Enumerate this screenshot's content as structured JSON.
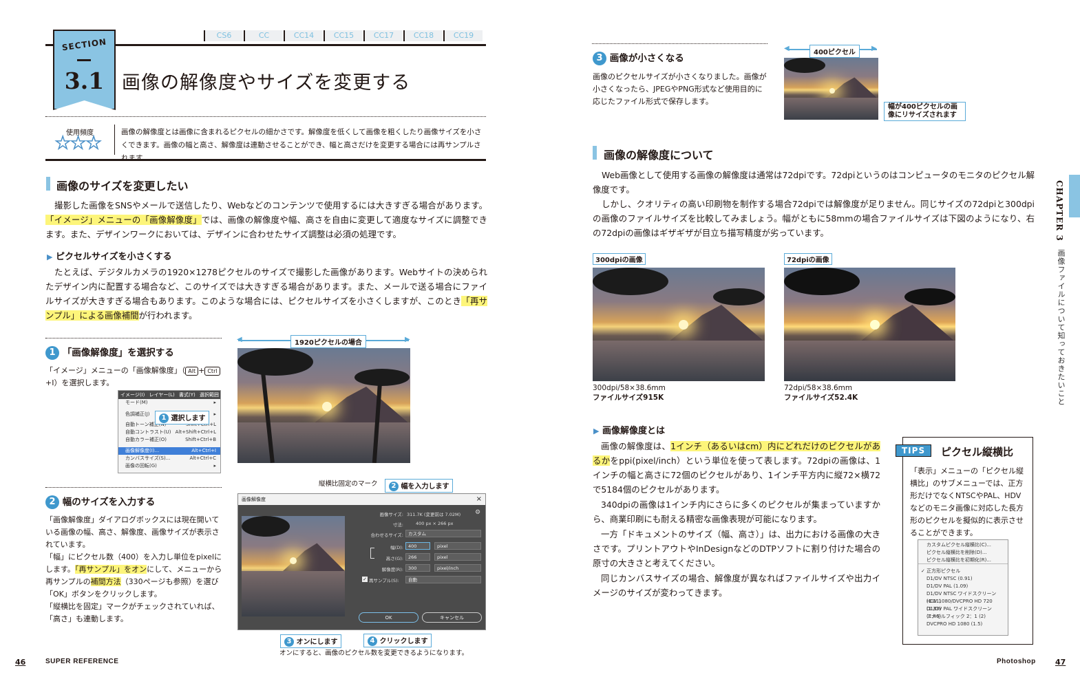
{
  "header": {
    "section_word": "SECTION",
    "section_num": "3.1",
    "title": "画像の解像度やサイズを変更する",
    "versions": [
      "CS6",
      "CC",
      "CC14",
      "CC15",
      "CC17",
      "CC18",
      "CC19"
    ]
  },
  "frequency": {
    "label": "使用頻度",
    "stars": "★★★",
    "rating": 3
  },
  "intro": "画像の解像度とは画像に含まれるピクセルの細かさです。解像度を低くして画像を粗くしたり画像サイズを小さくできます。画像の幅と高さ、解像度は連動させることができ、幅と高さだけを変更する場合には再サンプルされます。",
  "section_a": {
    "heading": "画像のサイズを変更したい",
    "p1_a": "撮影した画像をSNSやメールで送信したり、Webなどのコンテンツで使用するには大きすぎる場合があります。",
    "p1_hl": "「イメージ」メニューの「画像解像度」",
    "p1_b": "では、画像の解像度や幅、高さを自由に変更して適度なサイズに調整できます。また、デザインワークにおいては、デザインに合わせたサイズ調整は必須の処理です。",
    "sub": "ピクセルサイズを小さくする",
    "p2_a": "たとえば、デジタルカメラの1920×1278ピクセルのサイズで撮影した画像があります。Webサイトの決められたデザイン内に配置する場合など、このサイズでは大きすぎる場合があります。また、メールで送る場合にファイルサイズが大きすぎる場合もあります。このような場合には、ピクセルサイズを小さくしますが、このとき",
    "p2_hl": "「再サンプル」による画像補間",
    "p2_b": "が行われます。"
  },
  "step1": {
    "num": "1",
    "title": "「画像解像度」を選択する",
    "text_a": "「イメージ」メニューの「画像解像度」（",
    "key1": "Alt",
    "plus": "+",
    "key2": "Ctrl",
    "text_b": "+I）を選択します。",
    "callout_num": "1",
    "callout": "選択します",
    "menu_bar": "イメージ(I)  レイヤー(L)  書式(Y)  選択範囲",
    "menu_items": [
      {
        "label": "モード(M)",
        "shortcut": "▸"
      },
      {
        "label": "色調補正(J)",
        "shortcut": "▸"
      },
      {
        "label": "自動トーン補正(N)",
        "shortcut": "Shift+Ctrl+L"
      },
      {
        "label": "自動コントラスト(U)",
        "shortcut": "Alt+Shift+Ctrl+L"
      },
      {
        "label": "自動カラー補正(O)",
        "shortcut": "Shift+Ctrl+B"
      },
      {
        "label": "画像解像度(I)...",
        "shortcut": "Alt+Ctrl+I"
      },
      {
        "label": "カンバスサイズ(S)...",
        "shortcut": "Alt+Ctrl+C"
      },
      {
        "label": "画像の回転(G)",
        "shortcut": "▸"
      }
    ],
    "photo_label": "1920ピクセルの場合"
  },
  "step2": {
    "num": "2",
    "title": "幅のサイズを入力する",
    "t1": "「画像解像度」ダイアログボックスには現在開いている画像の幅、高さ、解像度、画像サイズが表示されています。",
    "t2": "「幅」にピクセル数（400）を入力し単位をpixelにします。",
    "t2_hl": "「再サンプル」をオン",
    "t3": "にして、メニューから再サンプルの",
    "t3_hl": "補間方法",
    "t4": "（330ページも参照）を選び「OK」ボタンをクリックします。",
    "t5": "「縦横比を固定」マークがチェックされていれば、「高さ」も連動します。",
    "mark_label": "縦横比固定のマーク",
    "c2_num": "2",
    "c2": "幅を入力します",
    "c3_num": "3",
    "c3": "オンにします",
    "c4_num": "4",
    "c4": "クリックします",
    "note": "オンにすると、画像のピクセル数を変更できるようになります。",
    "dialog": {
      "title": "画像解像度",
      "close": "×",
      "rows": [
        {
          "label": "画像サイズ:",
          "value": "311.7K (変更前は 7.02M)"
        },
        {
          "label": "寸法:",
          "value": "400 px × 266 px"
        },
        {
          "label": "合わせるサイズ:",
          "value": "カスタム"
        },
        {
          "label": "幅(D):",
          "value": "400",
          "unit": "pixel"
        },
        {
          "label": "高さ(G):",
          "value": "266",
          "unit": "pixel"
        },
        {
          "label": "解像度(R):",
          "value": "300",
          "unit": "pixel/inch"
        },
        {
          "label": "再サンプル(S):",
          "value": "自動"
        }
      ],
      "ok": "OK",
      "cancel": "キャンセル"
    }
  },
  "step3": {
    "num": "3",
    "title": "画像が小さくなる",
    "text": "画像のピクセルサイズが小さくなりました。画像が小さくなったら、JPEGやPNG形式など使用目的に応じたファイル形式で保存します。",
    "photo_label": "400ピクセル",
    "callout": "幅が400ピクセルの画像にリサイズされます"
  },
  "section_b": {
    "heading": "画像の解像度について",
    "p1": "Web画像として使用する画像の解像度は通常は72dpiです。72dpiというのはコンピュータのモニタのピクセル解像度です。",
    "p2": "しかし、クオリティの高い印刷物を制作する場合72dpiでは解像度が足りません。同じサイズの72dpiと300dpiの画像のファイルサイズを比較してみましょう。幅がともに58mmの場合ファイルサイズは下図のようになり、右の72dpiの画像はギザギザが目立ち描写精度が劣っています。",
    "img1_label": "300dpiの画像",
    "img1_cap1": "300dpi/58×38.6mm",
    "img1_cap2": "ファイルサイズ915K",
    "img2_label": "72dpiの画像",
    "img2_cap1": "72dpi/58×38.6mm",
    "img2_cap2": "ファイルサイズ52.4K",
    "sub": "画像解像度とは",
    "q1_a": "画像の解像度は、",
    "q1_hl": "1インチ（あるいはcm）内にどれだけのピクセルがあるか",
    "q1_b": "をppi(pixel/inch）という単位を使って表します。72dpiの画像は、1インチの幅と高さに72個のピクセルがあり、1インチ平方内に縦72×横72で5184個のピクセルがあります。",
    "q2": "340dpiの画像は1インチ内にさらに多くのピクセルが集まっていますから、商業印刷にも耐える精密な画像表現が可能になります。",
    "q3": "一方「ドキュメントのサイズ（幅、高さ）」は、出力における画像の大きさです。プリントアウトやInDesignなどのDTPソフトに割り付けた場合の原寸の大きさと考えてください。",
    "q4": "同じカンバスサイズの場合、解像度が異なればファイルサイズや出力イメージのサイズが変わってきます。"
  },
  "tips": {
    "badge": "TIPS",
    "title": "ピクセル縦横比",
    "text": "「表示」メニューの「ピクセル縦横比」のサブメニューでは、正方形だけでなくNTSCやPAL、HDVなどのモニタ画像に対応した長方形のピクセルを擬似的に表示させることができます。",
    "menu": [
      "カスタムピクセル縦横比(C)...",
      "ピクセル縦横比を削除(D)...",
      "ピクセル縦横比を初期化(R)...",
      "✓ 正方形ピクセル",
      "D1/DV NTSC (0.91)",
      "D1/DV PAL (1.09)",
      "D1/DV NTSC ワイドスクリーン (1.21)",
      "HDV 1080/DVCPRO HD 720 (1.33)",
      "D1/DV PAL ワイドスクリーン (1.46)",
      "アナモルフィック 2：1 (2)",
      "DVCPRO HD 1080 (1.5)"
    ]
  },
  "side": {
    "chapter": "CHAPTER 3",
    "subtitle": "画像ファイルについて知っておきたいこと"
  },
  "footer": {
    "left_num": "46",
    "left_text": "SUPER REFERENCE",
    "right_text": "Photoshop",
    "right_num": "47"
  }
}
